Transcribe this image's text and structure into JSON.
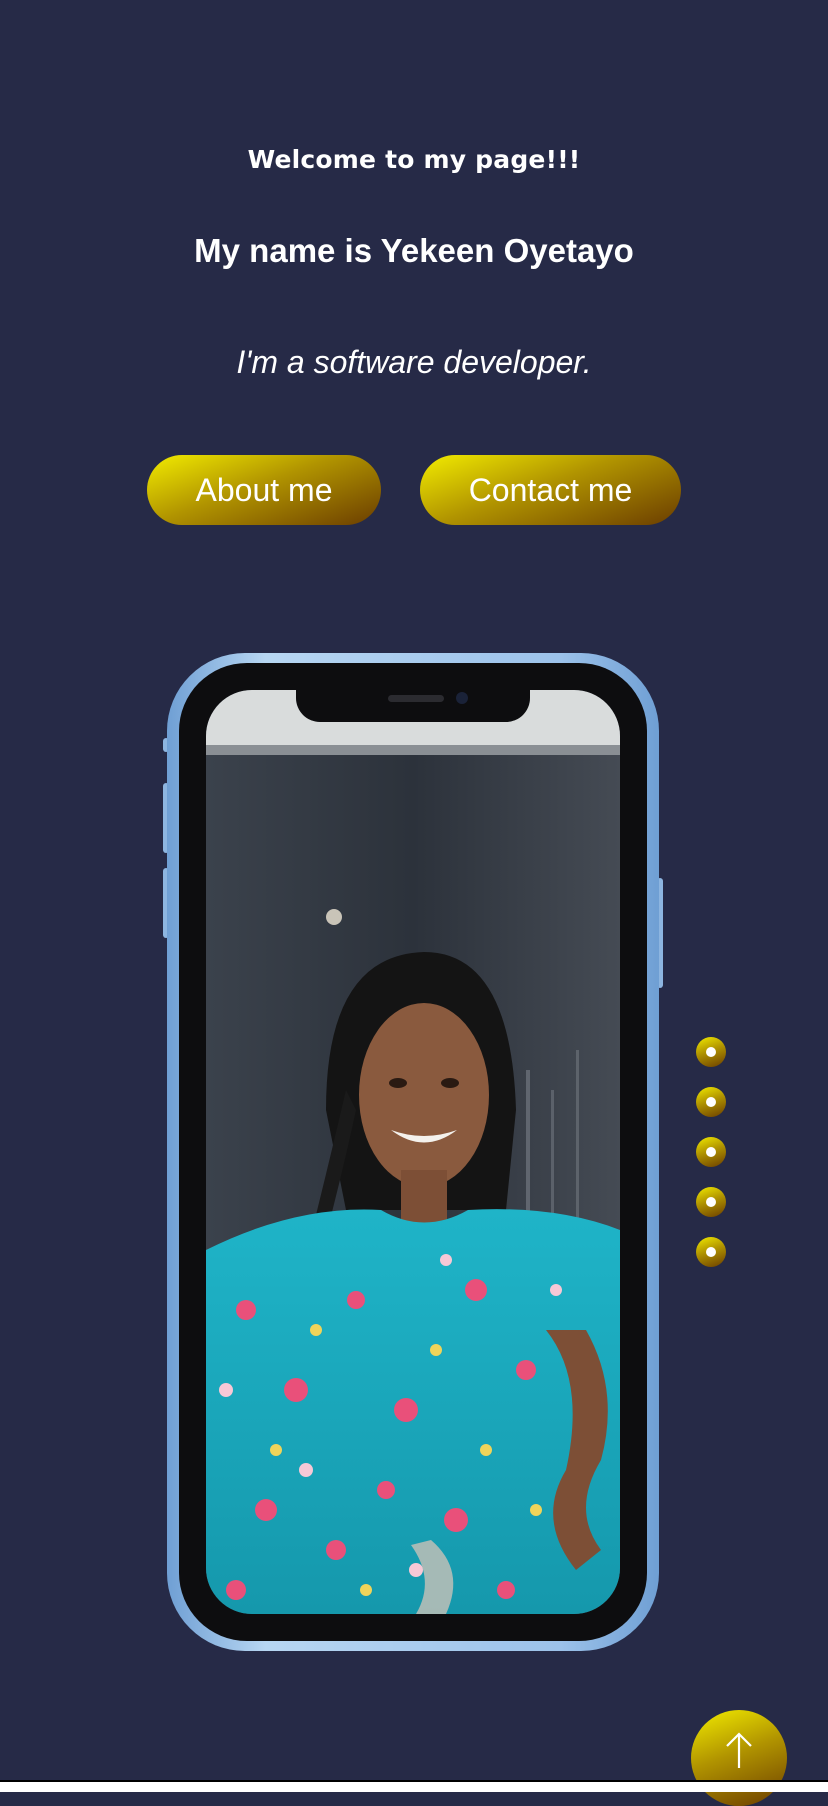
{
  "hero": {
    "welcome": "Welcome to my page!!!",
    "name": "My name is Yekeen Oyetayo",
    "role": "I'm a software developer."
  },
  "buttons": {
    "about_label": "About me",
    "contact_label": "Contact me"
  },
  "phone": {
    "photo_description": "portrait-photo"
  },
  "pagination": {
    "dots": 5,
    "icon": "dot-icon"
  },
  "scroll_top": {
    "icon": "arrow-up-icon"
  },
  "colors": {
    "background": "#262a47",
    "accent_start": "#f2ec00",
    "accent_end": "#6b3d00",
    "text": "#ffffff"
  }
}
